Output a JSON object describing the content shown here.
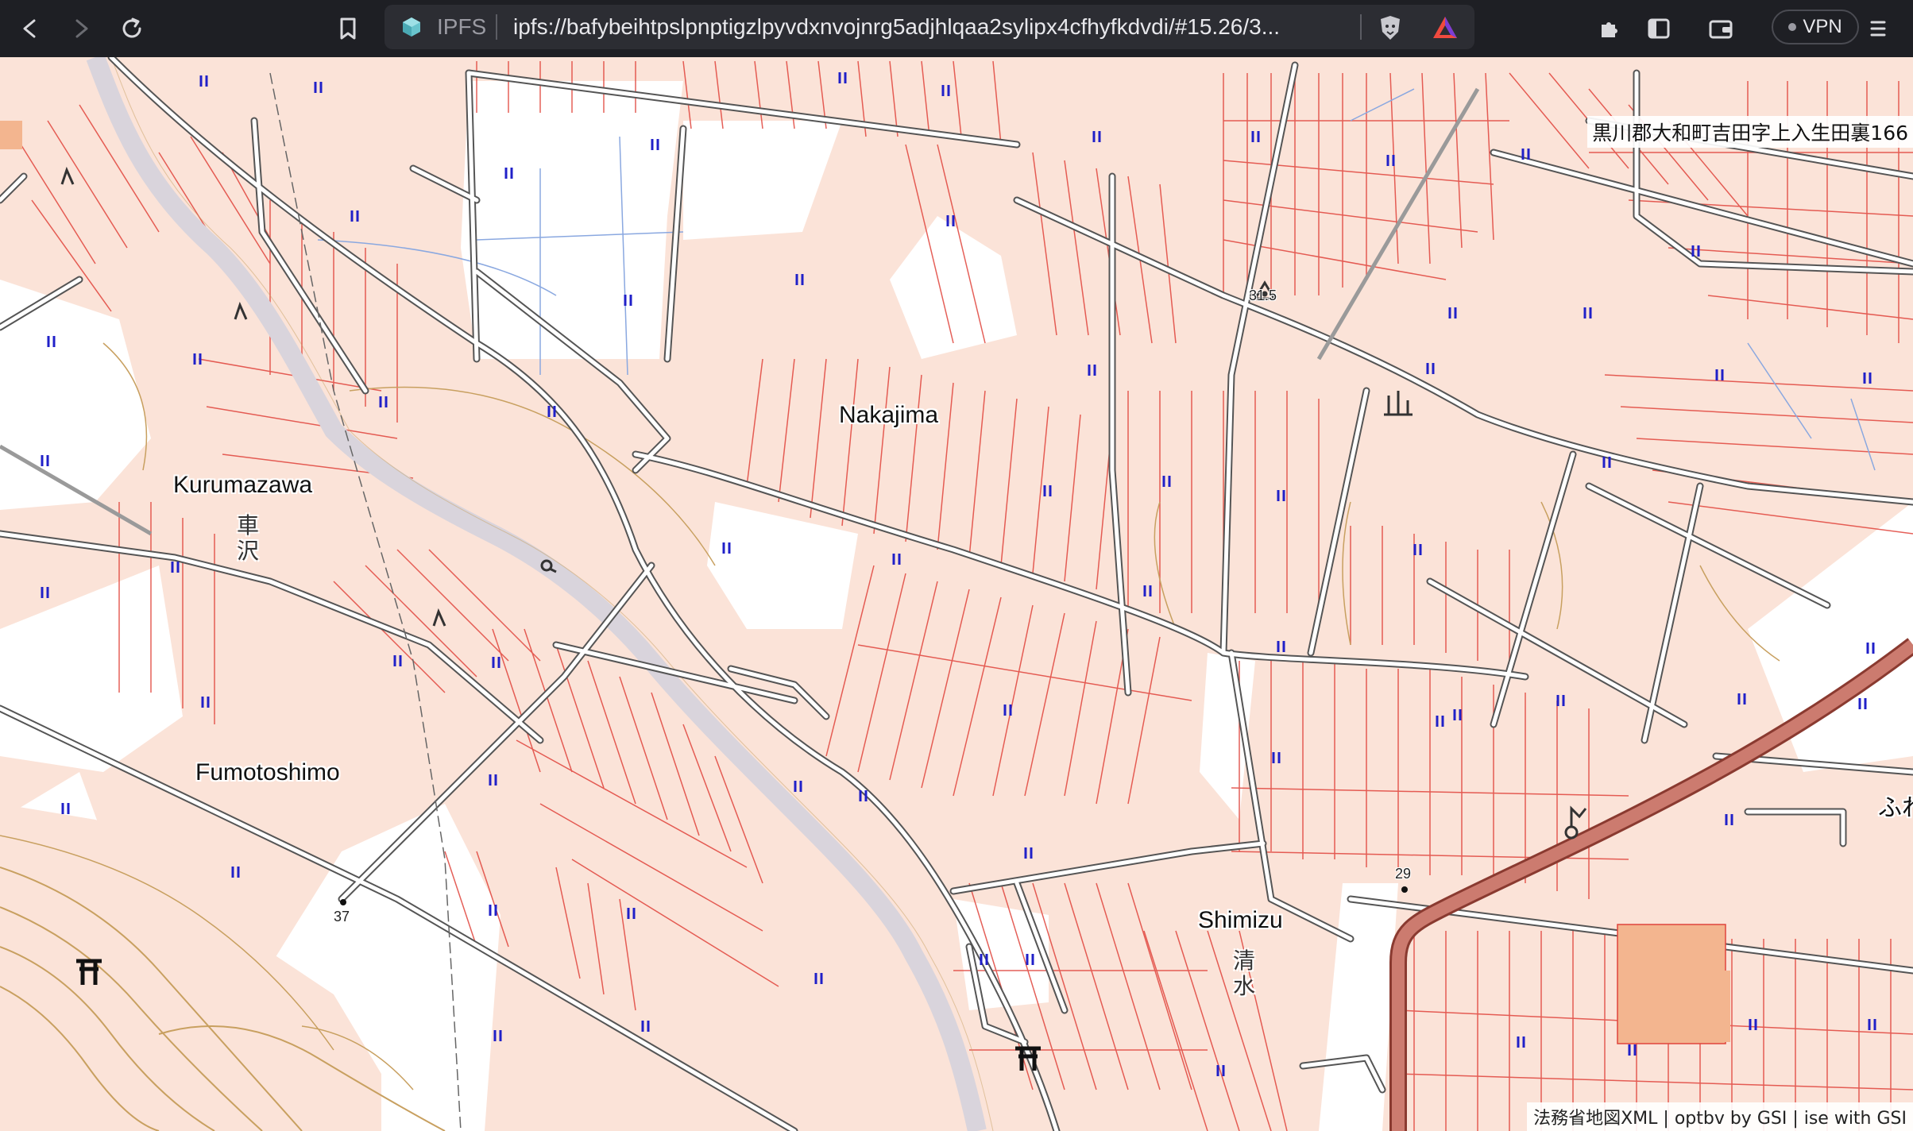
{
  "browser": {
    "back_icon": "back-arrow-icon",
    "forward_icon": "forward-arrow-icon",
    "reload_icon": "reload-icon",
    "bookmark_icon": "bookmark-icon",
    "site_label": "IPFS",
    "url": "ipfs://bafybeihtpslpnptigzlpyvdxnvojnrg5adjhlqaa2sylipx4cfhyfkdvdi/#15.26/3...",
    "vpn_label": "VPN",
    "extensions_icon": "puzzle-icon",
    "sidebar_icon": "sidebar-icon",
    "wallet_icon": "wallet-icon",
    "menu_icon": "hamburger-menu-icon"
  },
  "map": {
    "top_right_address": "黒川郡大和町吉田字上入生田裏166",
    "attribution": "法務省地図XML | optbv by GSI | ise with GSI",
    "place_names": {
      "nakajima": "Nakajima",
      "kurumazawa": "Kurumazawa",
      "kurumazawa_kanji_1": "車",
      "kurumazawa_kanji_2": "沢",
      "fumotoshimo": "Fumotoshimo",
      "shimizu": "Shimizu",
      "shimizu_kanji_1": "清",
      "shimizu_kanji_2": "水",
      "fureai_partial": "ふれ"
    },
    "elevations": {
      "triangulation_point": "31.5",
      "road_point_37": "37",
      "road_point_29": "29"
    },
    "colors": {
      "parcel_fill": "#fbe3d8",
      "parcel_line": "#e0443c",
      "road": "#ffffff",
      "road_casing": "#555555",
      "river": "#d9d4dc",
      "highway": "#cc7b6f",
      "paddy_symbol": "#2020c8",
      "contour": "#c8a060",
      "facility": "#f3b58f"
    }
  }
}
